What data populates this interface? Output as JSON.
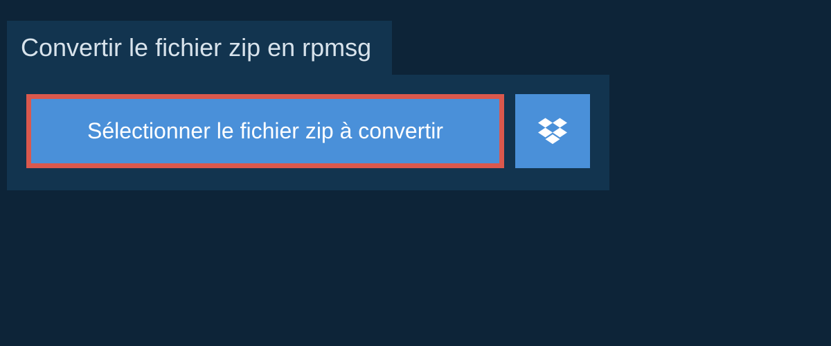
{
  "header": {
    "title": "Convertir le fichier zip en rpmsg"
  },
  "actions": {
    "select_file_label": "Sélectionner le fichier zip à convertir",
    "dropbox_icon": "dropbox-icon"
  },
  "colors": {
    "background": "#0d2438",
    "panel": "#12344f",
    "button": "#4a90d9",
    "highlight_border": "#da584d",
    "text_light": "#d8e3ec"
  }
}
